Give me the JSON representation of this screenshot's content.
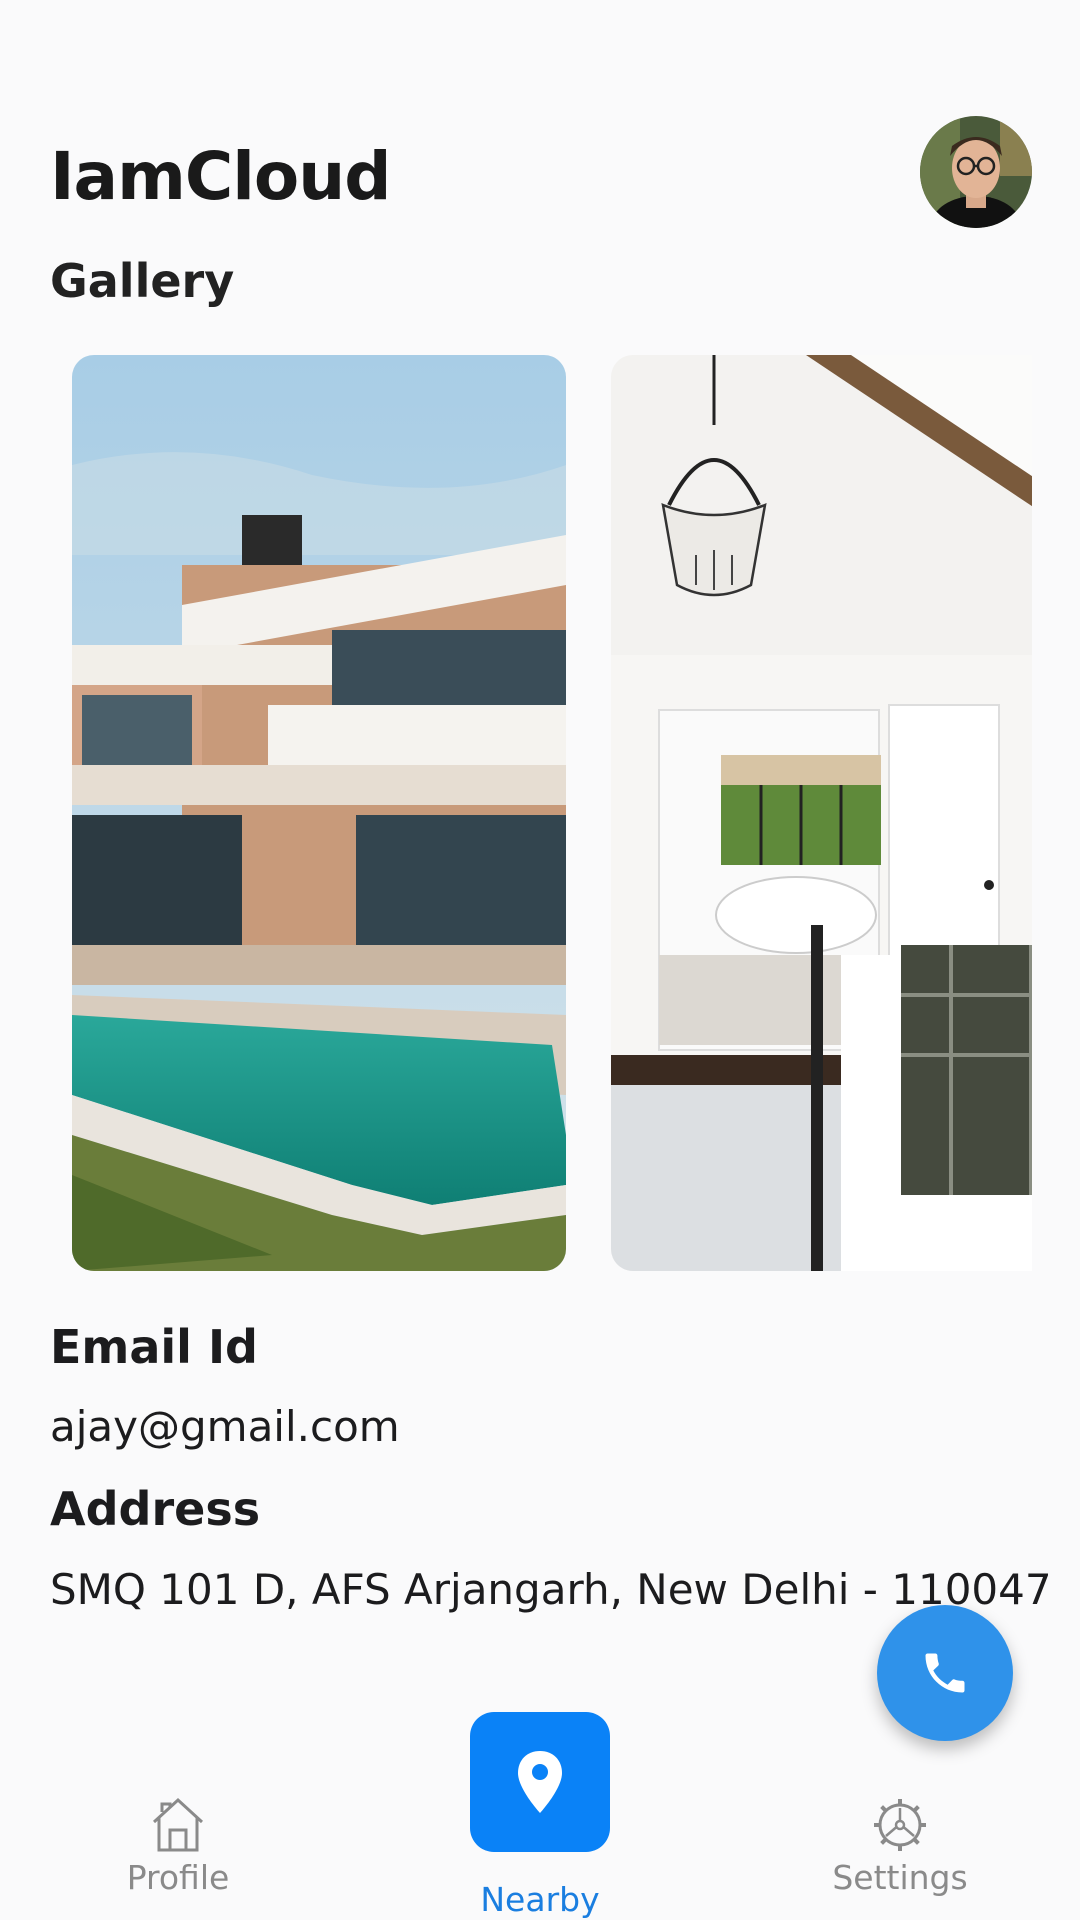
{
  "header": {
    "app_title": "IamCloud",
    "avatar": "user-avatar"
  },
  "gallery": {
    "title": "Gallery",
    "images": [
      {
        "name": "modern-villa-with-pool-image"
      },
      {
        "name": "bedroom-interior-image"
      }
    ]
  },
  "profile": {
    "email_label": "Email Id",
    "email_value": "ajay@gmail.com",
    "address_label": "Address",
    "address_value": "SMQ 101 D, AFS Arjangarh, New Delhi - 110047"
  },
  "fab": {
    "icon": "phone-icon",
    "color": "#2f92ea"
  },
  "bottom_nav": {
    "items": [
      {
        "label": "Profile",
        "icon": "home-icon",
        "active": false
      },
      {
        "label": "Nearby",
        "icon": "location-pin-icon",
        "active": true
      },
      {
        "label": "Settings",
        "icon": "gear-icon",
        "active": false
      }
    ],
    "active_color": "#0a82f7"
  }
}
